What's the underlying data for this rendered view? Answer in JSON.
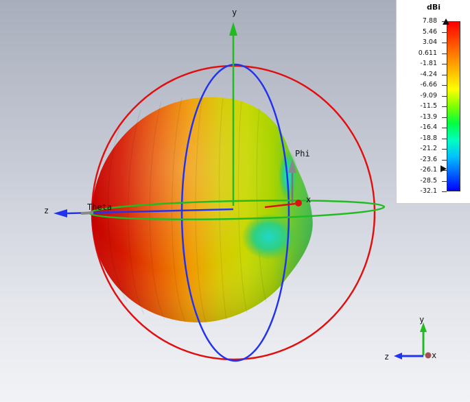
{
  "view": {
    "axis_labels": {
      "y": "y",
      "z": "z",
      "x": "x",
      "theta": "Theta",
      "phi": "Phi"
    },
    "mini_triad": {
      "y": "y",
      "z": "z",
      "x": "x"
    }
  },
  "legend": {
    "unit": "dBi",
    "ticks": [
      "7.88",
      "5.46",
      "3.04",
      "0.611",
      "-1.81",
      "-4.24",
      "-6.66",
      "-9.09",
      "-11.5",
      "-13.9",
      "-16.4",
      "-18.8",
      "-21.2",
      "-23.6",
      "-26.1",
      "-28.5",
      "-32.1"
    ],
    "max_value": 7.88,
    "min_value": -32.1,
    "colors": [
      "#ff0000",
      "#ff4000",
      "#ff8000",
      "#ffc000",
      "#ffff00",
      "#80ff00",
      "#00ff40",
      "#00ffc0",
      "#00c0ff",
      "#0060ff",
      "#0000ff"
    ]
  },
  "colors": {
    "x_axis": "#dd1111",
    "y_axis": "#22bb22",
    "z_axis": "#2222ee",
    "theta_ring": "#22bb22",
    "phi_ring_red": "#e01010",
    "phi_ring_blue": "#2233ee"
  }
}
